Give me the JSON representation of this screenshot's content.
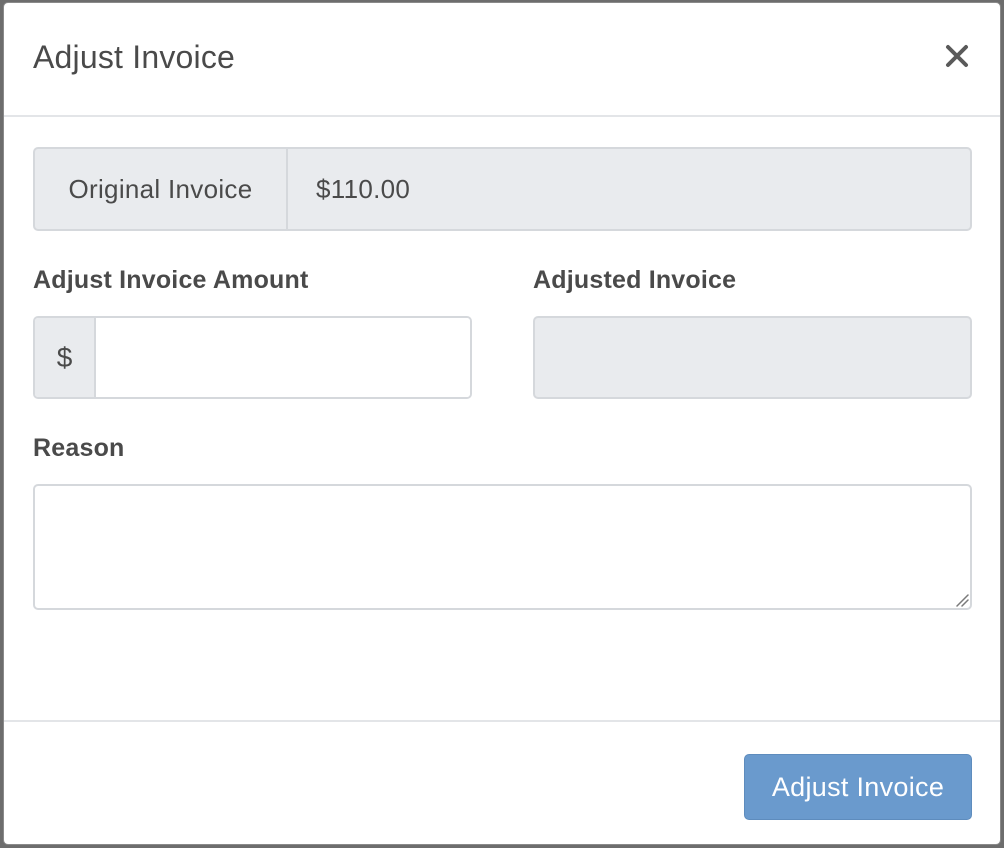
{
  "modal": {
    "title": "Adjust Invoice",
    "close_icon": "close-icon"
  },
  "original_invoice": {
    "label": "Original Invoice",
    "value": "$110.00"
  },
  "adjust_amount": {
    "label": "Adjust Invoice Amount",
    "prefix": "$",
    "value": "",
    "placeholder": ""
  },
  "adjusted_invoice": {
    "label": "Adjusted Invoice",
    "value": ""
  },
  "reason": {
    "label": "Reason",
    "value": "",
    "placeholder": ""
  },
  "footer": {
    "submit_label": "Adjust Invoice"
  },
  "colors": {
    "primary_button": "#6a9acd",
    "readonly_background": "#e9ebee",
    "border": "#d5d8dc",
    "text": "#4a4a4a"
  }
}
